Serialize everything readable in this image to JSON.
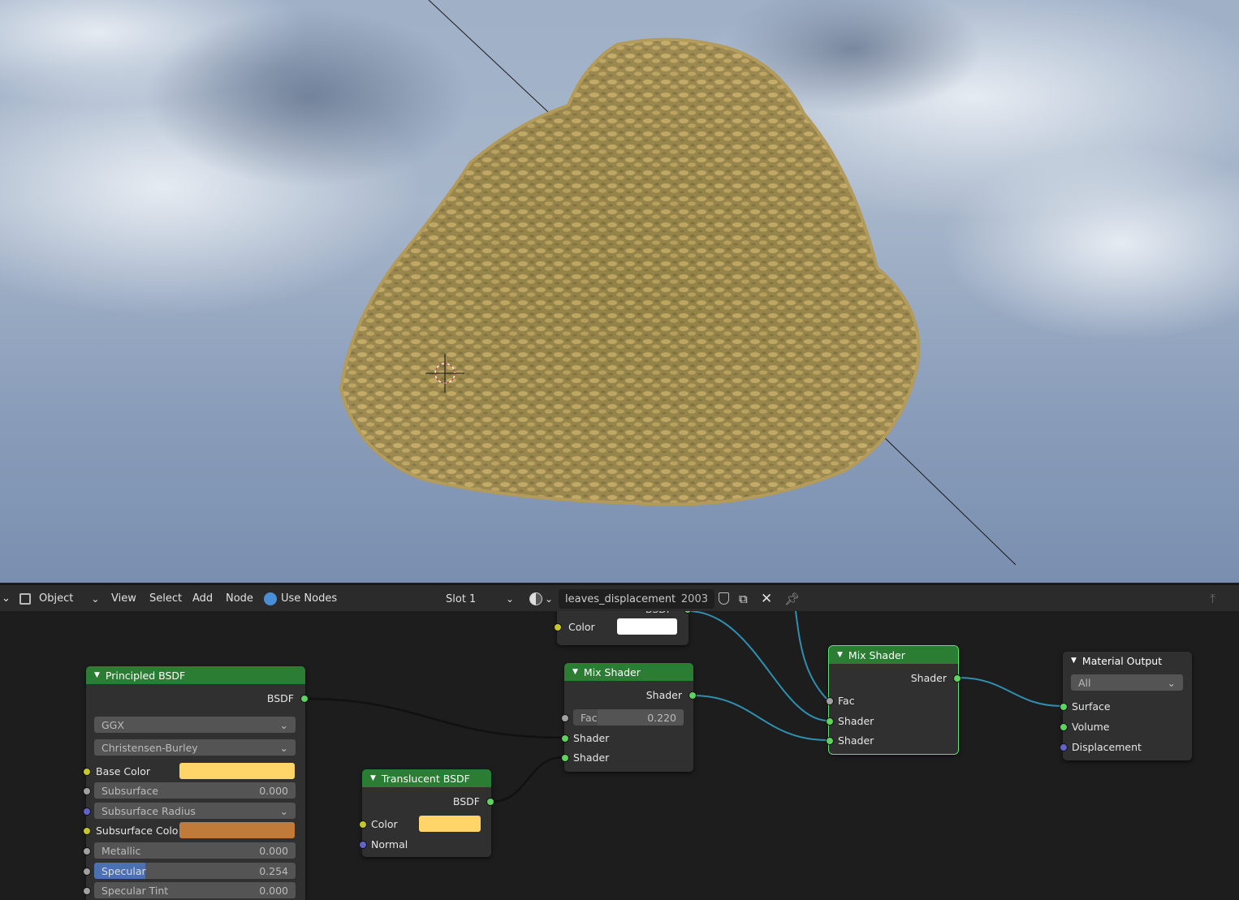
{
  "header": {
    "mode": "Object",
    "menus": [
      "View",
      "Select",
      "Add",
      "Node"
    ],
    "use_nodes": "Use Nodes",
    "slot": "Slot 1",
    "material": "leaves_displacement",
    "users": "2003"
  },
  "nodes": {
    "top_partial": {
      "output": "BSDF",
      "color_label": "Color",
      "color": "#ffffff"
    },
    "principled": {
      "title": "Principled BSDF",
      "output": "BSDF",
      "distribution": "GGX",
      "subsurface_method": "Christensen-Burley",
      "base_color_label": "Base Color",
      "base_color": "#ffd468",
      "subsurface_label": "Subsurface",
      "subsurface": "0.000",
      "subsurface_radius": "Subsurface Radius",
      "subsurface_color_label": "Subsurface Colo",
      "subsurface_color": "#c07a3a",
      "metallic_label": "Metallic",
      "metallic": "0.000",
      "specular_label": "Specular",
      "specular": "0.254",
      "specular_fill": 0.254,
      "specular_tint_label": "Specular Tint",
      "specular_tint": "0.000"
    },
    "translucent": {
      "title": "Translucent BSDF",
      "output": "BSDF",
      "color_label": "Color",
      "color": "#ffd468",
      "normal": "Normal"
    },
    "mix1": {
      "title": "Mix Shader",
      "output": "Shader",
      "fac_label": "Fac",
      "fac": "0.220",
      "fac_fill": 0.22,
      "in1": "Shader",
      "in2": "Shader"
    },
    "mix2": {
      "title": "Mix Shader",
      "output": "Shader",
      "fac": "Fac",
      "in1": "Shader",
      "in2": "Shader"
    },
    "output": {
      "title": "Material Output",
      "target": "All",
      "surface": "Surface",
      "volume": "Volume",
      "displacement": "Displacement"
    }
  },
  "colors": {
    "node_header": "#2a7d32",
    "link_shader": "#2f8fb0",
    "link_dark": "#111111"
  }
}
